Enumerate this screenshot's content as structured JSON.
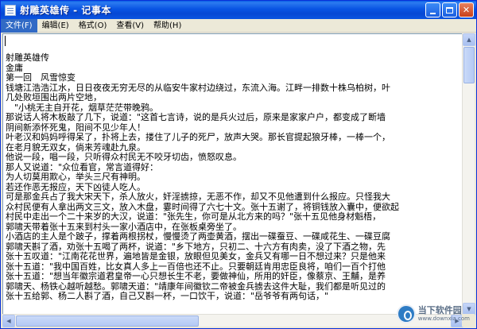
{
  "window": {
    "title": "射雕英雄传 - 记事本",
    "icon": "notepad-icon"
  },
  "menu": [
    {
      "label": "文件(F)"
    },
    {
      "label": "编辑(E)"
    },
    {
      "label": "格式(O)"
    },
    {
      "label": "查看(V)"
    },
    {
      "label": "帮助(H)"
    }
  ],
  "document": {
    "lines": [
      "射雕英雄传",
      "金庸",
      "第一回　风雪惊变",
      "钱塘江浩浩江水，日日夜夜无穷无尽的从临安牛家村边绕过，东流入海。江畔一排数十株乌柏树，叶",
      "几处败垣围出两片空地，",
      "　\"小桃无主自开花，烟草茫茫带晚鸦。",
      "那说话人将木板敲了几下，说道：\"这首七言诗，说的是兵火过后，原来是家家户户，都变成了断墙",
      "阴间新添怀死鬼，阳间不见少年人！",
      "叶老汉和妈妈呼得呆了，扑将上去，搂住了儿子的死尸，放声大哭。那长官提起狼牙棒，一棒一个，",
      "在老月貌无双女，倘来芳魂赴九泉。",
      "他说一段，唱一段，只听得众村民无不咬牙切齿，愤怒叹息。",
      "那人又说道：\"众位看官，常言道得好：",
      "为人切莫用欺心，举头三尺有神明。",
      "若还作恶无报应，天下凶徒人吃人。",
      "可是那金兵占了我大宋天下，杀人放火，奸淫掳掠，无恶不作，却又不见他遭到什么报应。只怪我大",
      "众村民便有人拿出两文三文，放入木盘，霎时间得了六七十文。张十五谢了，将铜钱放入囊中，便欲起",
      "村民中走出一个二十来岁的大汉，说道：\"张先生，你可是从北方来的吗？\"张十五见他身材魁梧，",
      "郭啸天带着张十五来到村头一家小酒店中，在张板桌旁坐了。",
      "小酒店的主人是个跛子，撑着两根拐杖，慢慢烫了两壶黄酒，摆出一碟蚕豆、一碟咸花生、一碟豆腐",
      "郭啸天斟了酒，劝张十五喝了两杯，说道：\"乡下地方，只初二、十六方有肉卖，没了下酒之物，先",
      "张十五叹道：\"江南花花世界，遍地皆是金银，放眼但见美女，金兵又有哪一日不想过来？只是他来",
      "张十五道：\"我中国百姓，比女真人多上一百倍也还不止。只要朝廷肯用忠臣良将，咱们一百个打他",
      "张十五道：\"想当年徽宗道君皇帝一心只想长生不老，要做神仙，所用的奸臣，像蔡京、王黼，是养",
      "郭啸天、杨铁心越听越愁。郭啸天道：\"靖康年间徽钦二帝被金兵掳去这件大耻，我们都是听见过的",
      "张十五给郭、杨二人斟了酒，自己又斟一杯，一口饮干，说道：\"岳爷爷有两句话，\""
    ]
  },
  "scrollbars": {
    "vertical_up": "▲",
    "vertical_down": "▼",
    "horizontal_left": "◀",
    "horizontal_right": "▶"
  },
  "watermark": {
    "name": "当下软件园",
    "url": "www.downxia.com",
    "icon": "downxia-logo-icon"
  }
}
